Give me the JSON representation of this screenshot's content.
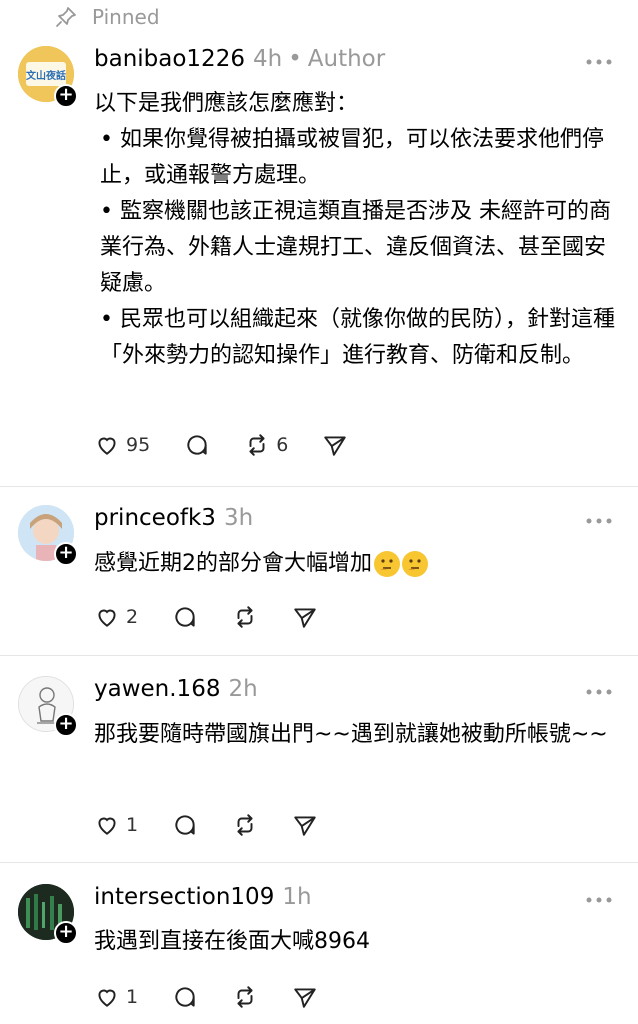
{
  "pinned_label": "Pinned",
  "posts": [
    {
      "username": "banibao1226",
      "time": "4h",
      "separator": "•",
      "role": "Author",
      "avatar_text": "文山夜話",
      "paragraphs": [
        "以下是我們應該怎麼應對：",
        "• 如果你覺得被拍攝或被冒犯，可以依法要求他們停止，或通報警方處理。",
        "• 監察機關也該正視這類直播是否涉及 未經許可的商業行為、外籍人士違規打工、違反個資法、甚至國安疑慮。",
        "• 民眾也可以組織起來（就像你做的民防），針對這種「外來勢力的認知操作」進行教育、防衛和反制。"
      ],
      "likes": "95",
      "reposts": "6"
    },
    {
      "username": "princeofk3",
      "time": "3h",
      "text": "感覺近期2的部分會大幅增加",
      "emoji_name": "thinking-face",
      "likes": "2"
    },
    {
      "username": "yawen.168",
      "time": "2h",
      "text": "那我要隨時帶國旗出門~~遇到就讓她被動所帳號~~",
      "likes": "1"
    },
    {
      "username": "intersection109",
      "time": "1h",
      "text": "我遇到直接在後面大喊8964",
      "likes": "1"
    }
  ]
}
